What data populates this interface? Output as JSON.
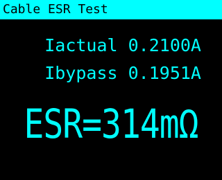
{
  "window": {
    "title": "Cable ESR Test"
  },
  "readings": {
    "iactual": "Iactual 0.2100A",
    "ibypass": "Ibypass 0.1951A"
  },
  "result": {
    "esr": "ESR=314mΩ"
  },
  "colors": {
    "accent": "#00FFFF",
    "background": "#000000",
    "title_text": "#000000"
  }
}
